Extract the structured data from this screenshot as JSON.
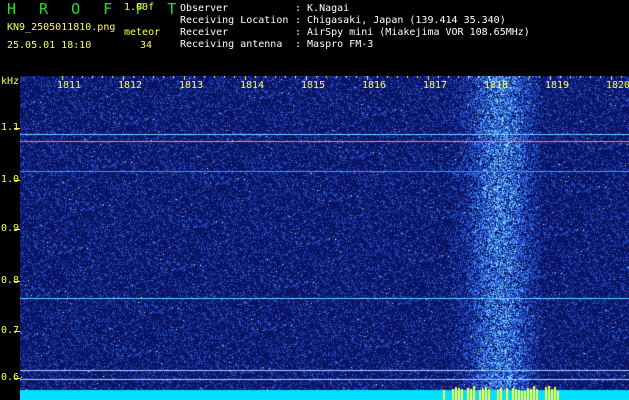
{
  "header": {
    "app_title": "H R O F F T",
    "version": "1.00f",
    "filename": "KN9_2505011810.png",
    "meteor_label": "meteor",
    "datetime": "25.05.01 18:10",
    "meteor_count": "34",
    "meta": [
      {
        "key": "Observer",
        "value": ": K.Nagai"
      },
      {
        "key": "Receiving Location",
        "value": ": Chigasaki, Japan (139.414 35.340)"
      },
      {
        "key": "Receiver",
        "value": ": AirSpy mini (Miakejima VOR 108.65MHz)"
      },
      {
        "key": "Receiving antenna",
        "value": ": Maspro FM-3"
      }
    ]
  },
  "plot": {
    "y_unit": "kHz",
    "x_ticks": [
      "1811",
      "1812",
      "1813",
      "1814",
      "1815",
      "1816",
      "1817",
      "1818",
      "1819",
      "1820"
    ],
    "y_ticks": [
      "1.1",
      "1.0",
      "0.9",
      "0.8",
      "0.7",
      "0.6"
    ],
    "colors": {
      "background": "#0a1466",
      "noise": "#3a6cff",
      "tick_text": "#ffff44",
      "title": "#22e022",
      "bottom_band": "#00e0ff",
      "signal_line": "#ff8080"
    }
  }
}
